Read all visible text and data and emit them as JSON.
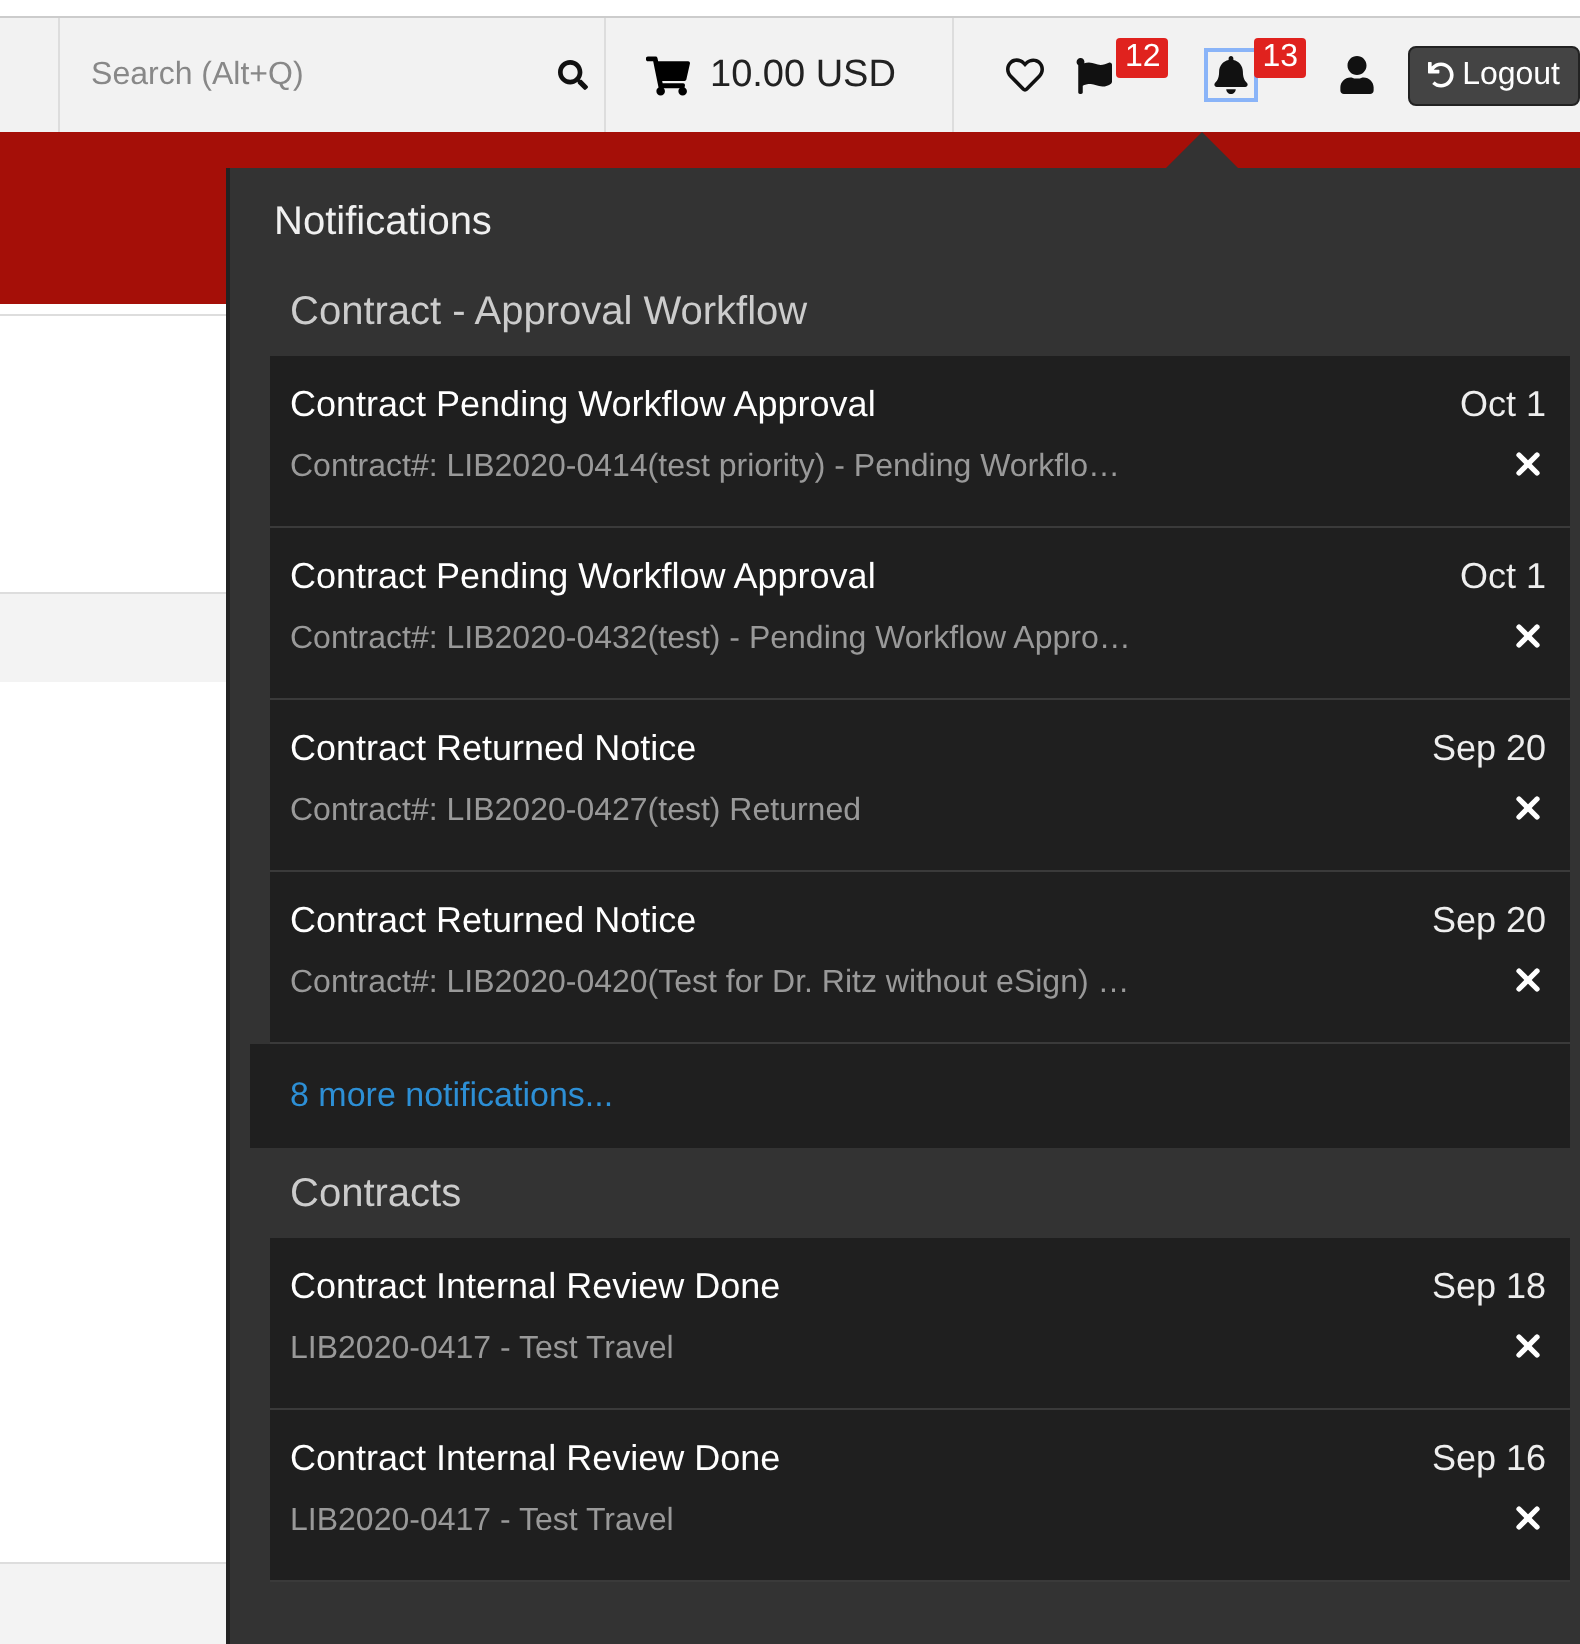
{
  "topbar": {
    "search": {
      "placeholder": "Search (Alt+Q)"
    },
    "cart_total": "10.00 USD",
    "flag_count": "12",
    "bell_count": "13",
    "bell_focused": true,
    "logout": "Logout"
  },
  "notifications": {
    "title": "Notifications",
    "groups": [
      {
        "title": "Contract - Approval Workflow",
        "items": [
          {
            "title": "Contract Pending Workflow Approval",
            "detail": "Contract#: LIB2020-0414(test priority) - Pending Workflo…",
            "date": "Oct 1"
          },
          {
            "title": "Contract Pending Workflow Approval",
            "detail": "Contract#: LIB2020-0432(test) - Pending Workflow Appro…",
            "date": "Oct 1"
          },
          {
            "title": "Contract Returned Notice",
            "detail": "Contract#: LIB2020-0427(test) Returned",
            "date": "Sep 20"
          },
          {
            "title": "Contract Returned Notice",
            "detail": "Contract#: LIB2020-0420(Test for Dr. Ritz without eSign) …",
            "date": "Sep 20"
          }
        ],
        "more": "8 more notifications..."
      },
      {
        "title": "Contracts",
        "items": [
          {
            "title": "Contract Internal Review Done",
            "detail": "LIB2020-0417 - Test Travel",
            "date": "Sep 18"
          },
          {
            "title": "Contract Internal Review Done",
            "detail": "LIB2020-0417 - Test Travel",
            "date": "Sep 16"
          }
        ]
      }
    ]
  }
}
